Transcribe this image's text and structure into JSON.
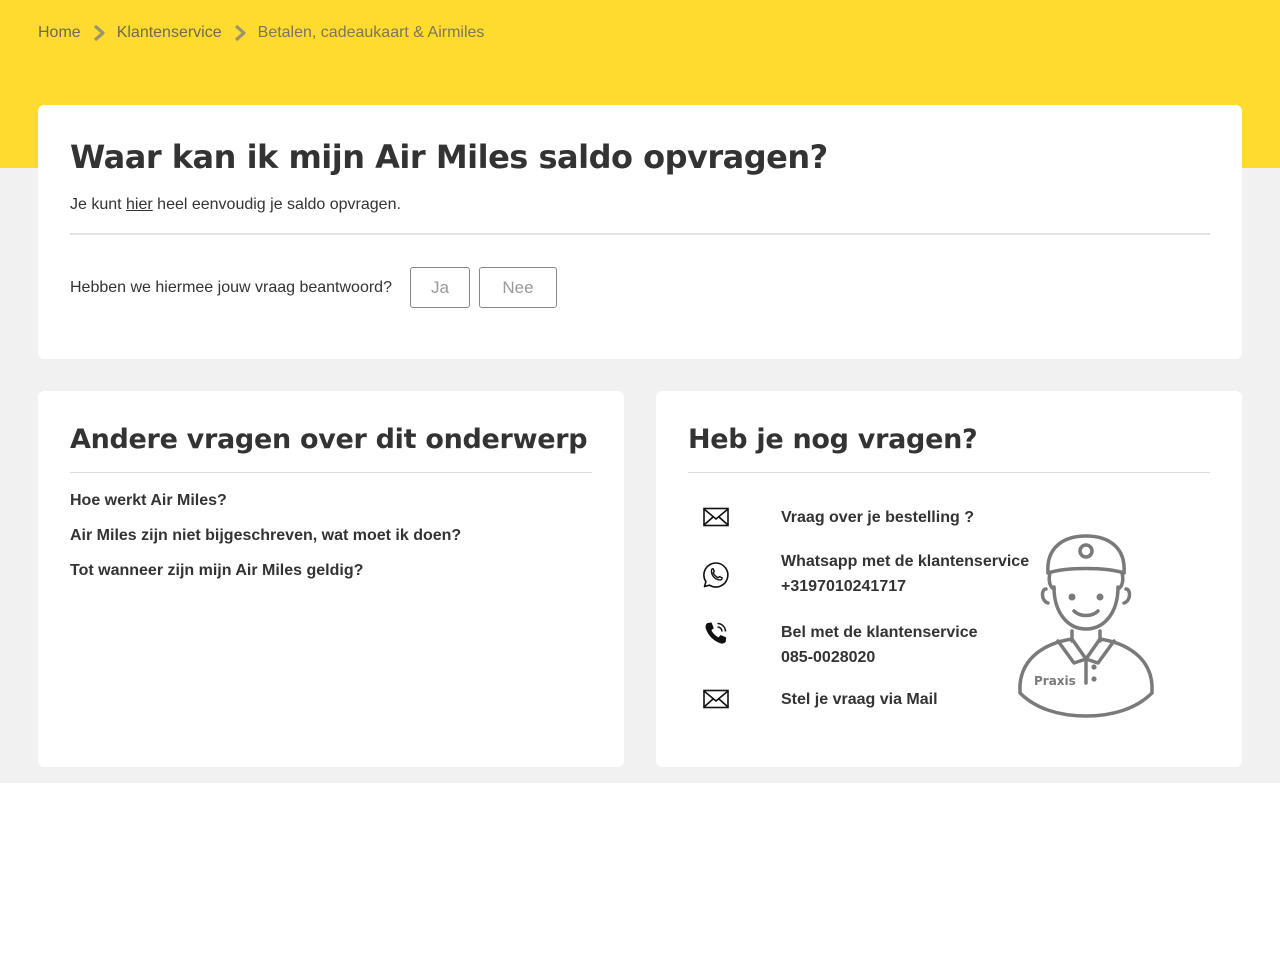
{
  "breadcrumb": {
    "home": "Home",
    "klantenservice": "Klantenservice",
    "current": "Betalen, cadeaukaart & Airmiles"
  },
  "question": {
    "title": "Waar kan ik mijn Air Miles saldo opvragen?",
    "answer_prefix": "Je kunt ",
    "answer_link": "hier",
    "answer_suffix": " heel eenvoudig je saldo opvragen."
  },
  "feedback": {
    "question": "Hebben we hiermee jouw vraag beantwoord?",
    "yes": "Ja",
    "no": "Nee"
  },
  "related": {
    "title": "Andere vragen over dit onderwerp",
    "items": [
      "Hoe werkt Air Miles?",
      "Air Miles zijn niet bijgeschreven, wat moet ik doen?",
      "Tot wanneer zijn mijn Air Miles geldig?"
    ]
  },
  "contact": {
    "title": "Heb je nog vragen?",
    "items": [
      {
        "icon": "mail-icon",
        "line1": "Vraag over je bestelling ?",
        "line2": ""
      },
      {
        "icon": "whatsapp-icon",
        "line1": "Whatsapp met de klantenservice",
        "line2": "+3197010241717"
      },
      {
        "icon": "phone-icon",
        "line1": "Bel met de klantenservice",
        "line2": "085-0028020"
      },
      {
        "icon": "mail-icon",
        "line1": "Stel je vraag via Mail",
        "line2": ""
      }
    ],
    "mascot_logo_text": "Praxis"
  },
  "colors": {
    "brand_yellow": "#ffdb30",
    "page_gray": "#f1f1f1",
    "text_dark": "#333333"
  }
}
